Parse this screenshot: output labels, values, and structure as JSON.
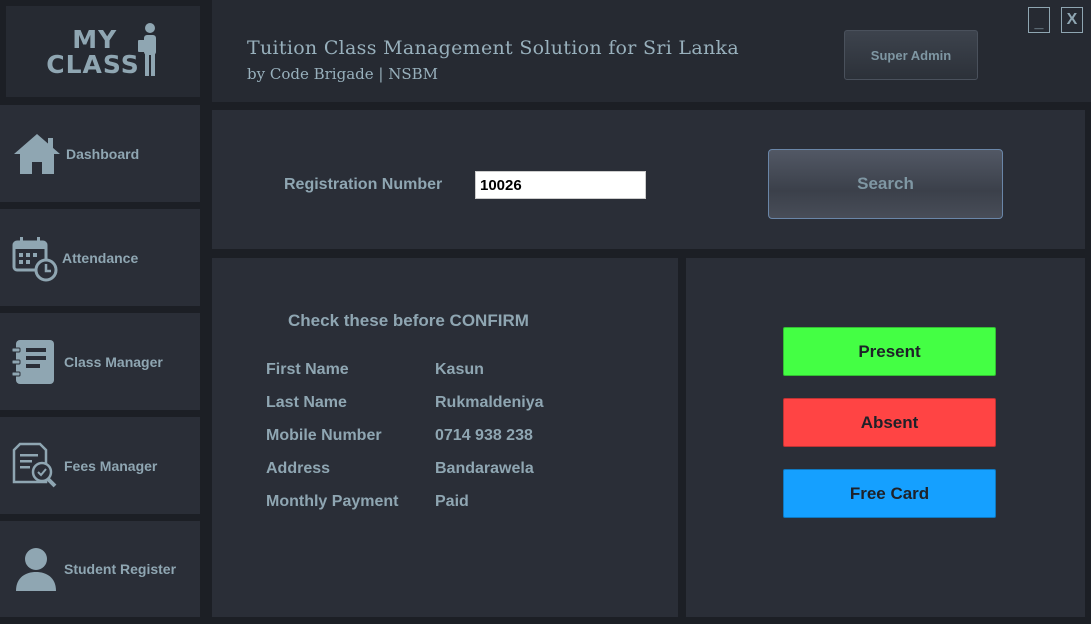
{
  "brand": {
    "logo_line1": "MY",
    "logo_line2": "CLASS"
  },
  "header": {
    "title": "Tuition Class Management Solution for Sri Lanka",
    "subtitle": "by Code Brigade | NSBM",
    "user_button": "Super Admin",
    "minimize_label": "_",
    "close_label": "X"
  },
  "sidebar": {
    "items": [
      {
        "label": "Dashboard",
        "icon": "home-icon"
      },
      {
        "label": "Attendance",
        "icon": "calendar-clock-icon"
      },
      {
        "label": "Class Manager",
        "icon": "notebook-icon"
      },
      {
        "label": "Fees Manager",
        "icon": "document-search-icon"
      },
      {
        "label": "Student Register",
        "icon": "user-icon"
      }
    ]
  },
  "search": {
    "label": "Registration Number",
    "value": "10026",
    "button": "Search"
  },
  "details": {
    "title": "Check these before CONFIRM",
    "fields": [
      {
        "label": "First Name",
        "value": "Kasun"
      },
      {
        "label": "Last Name",
        "value": "Rukmaldeniya"
      },
      {
        "label": "Mobile Number",
        "value": "0714 938 238"
      },
      {
        "label": "Address",
        "value": "Bandarawela"
      },
      {
        "label": "Monthly Payment",
        "value": "Paid"
      }
    ]
  },
  "actions": {
    "present": "Present",
    "absent": "Absent",
    "free_card": "Free Card"
  },
  "colors": {
    "present": "#44ff44",
    "absent": "#ff4444",
    "free_card": "#15a0ff",
    "panel": "#2a2e37",
    "text": "#8fa6b2"
  }
}
